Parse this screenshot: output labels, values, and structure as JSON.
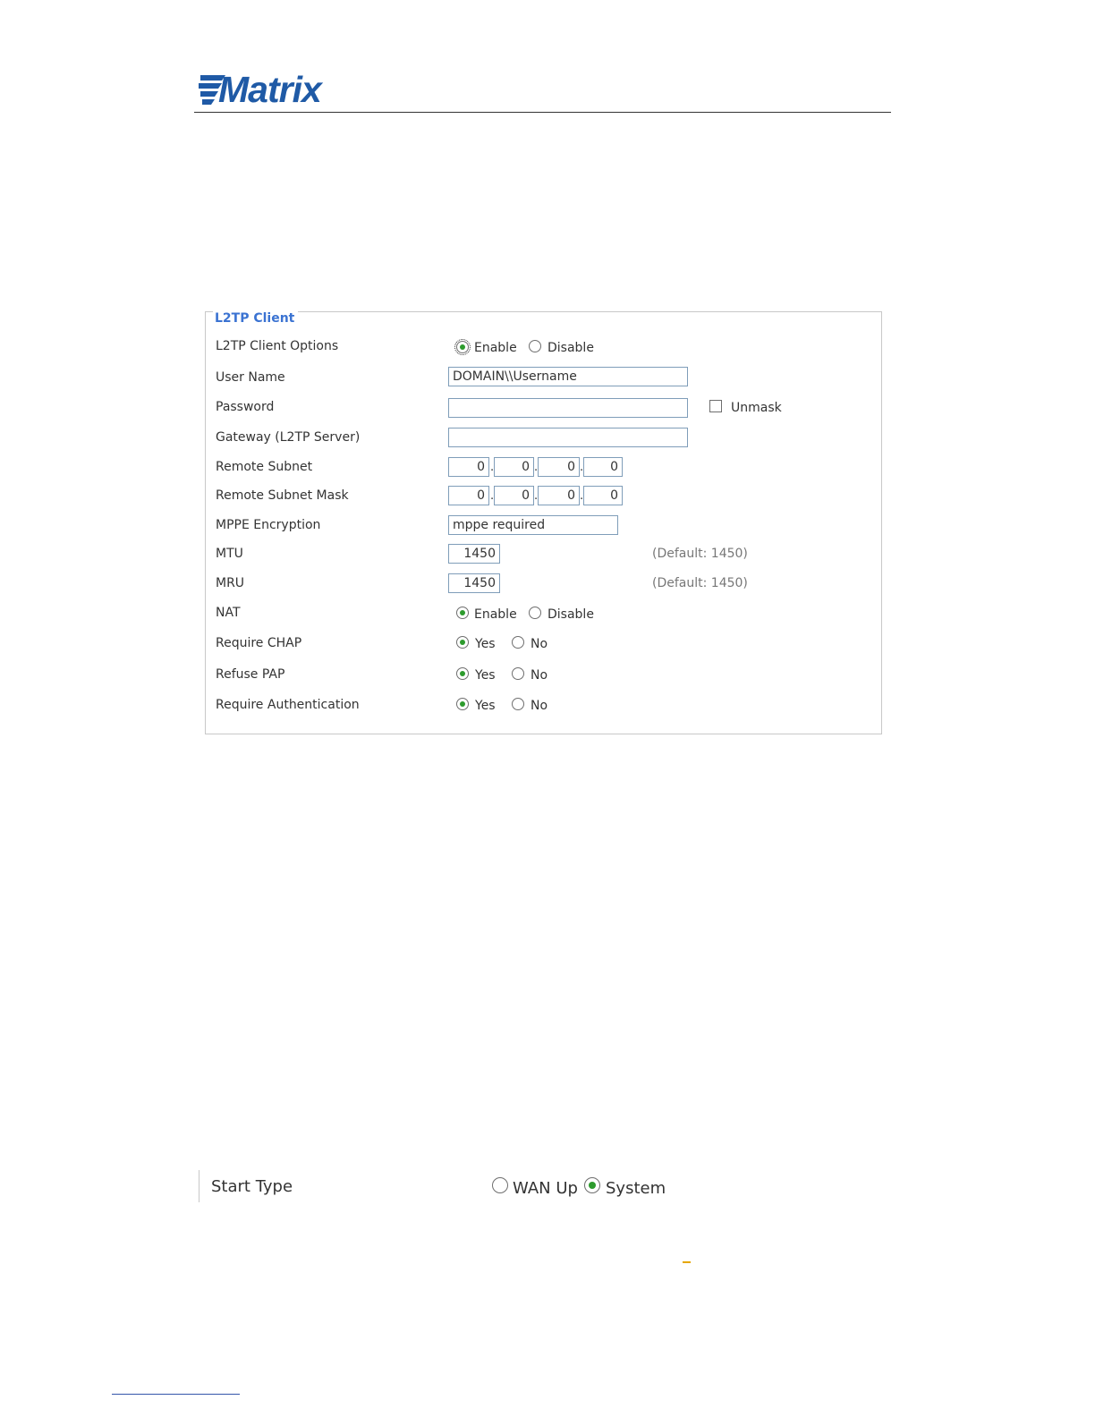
{
  "logo": {
    "text": "Matrix"
  },
  "panel": {
    "legend": "L2TP Client",
    "rows": {
      "client_options": {
        "label": "L2TP Client Options",
        "opt1": "Enable",
        "opt2": "Disable"
      },
      "username": {
        "label": "User Name",
        "value": "DOMAIN\\\\Username"
      },
      "password": {
        "label": "Password",
        "value": "",
        "unmask": "Unmask"
      },
      "gateway": {
        "label": "Gateway (L2TP Server)",
        "value": ""
      },
      "remote_subnet": {
        "label": "Remote Subnet",
        "octets": [
          "0",
          "0",
          "0",
          "0"
        ]
      },
      "remote_mask": {
        "label": "Remote Subnet Mask",
        "octets": [
          "0",
          "0",
          "0",
          "0"
        ]
      },
      "mppe": {
        "label": "MPPE Encryption",
        "value": "mppe required"
      },
      "mtu": {
        "label": "MTU",
        "value": "1450",
        "hint": "(Default: 1450)"
      },
      "mru": {
        "label": "MRU",
        "value": "1450",
        "hint": "(Default: 1450)"
      },
      "nat": {
        "label": "NAT",
        "opt1": "Enable",
        "opt2": "Disable"
      },
      "chap": {
        "label": "Require CHAP",
        "opt1": "Yes",
        "opt2": "No"
      },
      "pap": {
        "label": "Refuse PAP",
        "opt1": "Yes",
        "opt2": "No"
      },
      "auth": {
        "label": "Require Authentication",
        "opt1": "Yes",
        "opt2": "No"
      }
    }
  },
  "start_type": {
    "label": "Start Type",
    "opt1": "WAN Up",
    "opt2": "System"
  }
}
